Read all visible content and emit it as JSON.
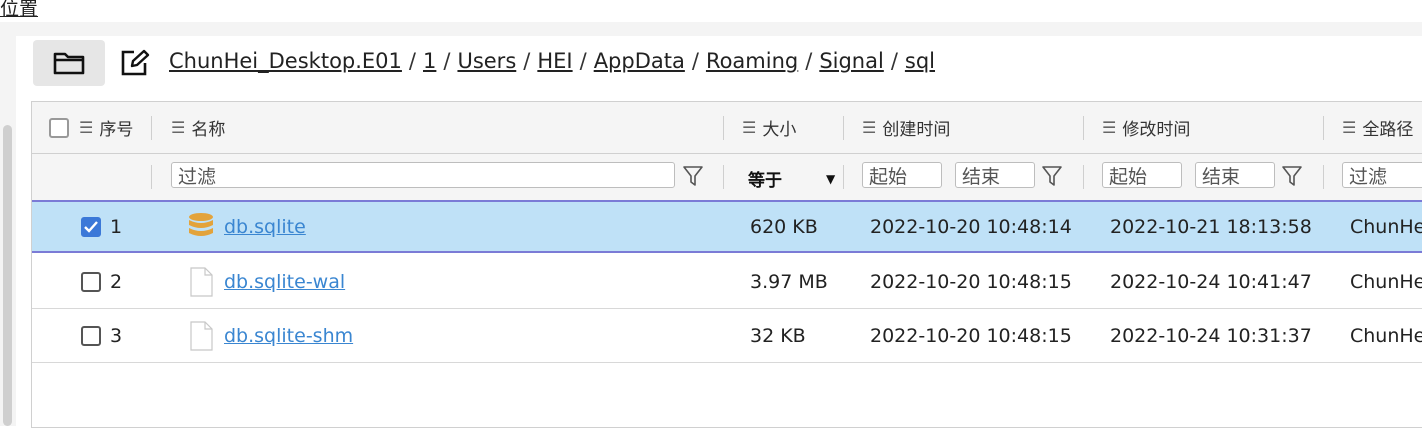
{
  "top_label": "位置",
  "breadcrumb": [
    {
      "label": "ChunHei_Desktop.E01"
    },
    {
      "label": "1"
    },
    {
      "label": "Users"
    },
    {
      "label": "HEI"
    },
    {
      "label": "AppData"
    },
    {
      "label": "Roaming"
    },
    {
      "label": "Signal"
    },
    {
      "label": "sql"
    }
  ],
  "breadcrumb_separator": "/",
  "columns": {
    "index": "序号",
    "name": "名称",
    "size": "大小",
    "created": "创建时间",
    "modified": "修改时间",
    "fullpath": "全路径"
  },
  "filters": {
    "name_placeholder": "过滤",
    "size_operator": "等于",
    "created_start": "起始",
    "created_end": "结束",
    "modified_start": "起始",
    "modified_end": "结束",
    "fullpath_placeholder": "过滤"
  },
  "rows": [
    {
      "index": "1",
      "checked": true,
      "icon": "database-icon",
      "name": "db.sqlite",
      "size": "620 KB",
      "created": "2022-10-20 10:48:14",
      "modified": "2022-10-21 18:13:58",
      "fullpath": "ChunHe"
    },
    {
      "index": "2",
      "checked": false,
      "icon": "file-icon",
      "name": "db.sqlite-wal",
      "size": "3.97 MB",
      "created": "2022-10-20 10:48:15",
      "modified": "2022-10-24 10:41:47",
      "fullpath": "ChunHe"
    },
    {
      "index": "3",
      "checked": false,
      "icon": "file-icon",
      "name": "db.sqlite-shm",
      "size": "32 KB",
      "created": "2022-10-20 10:48:15",
      "modified": "2022-10-24 10:31:37",
      "fullpath": "ChunHe"
    }
  ],
  "colors": {
    "selected_row": "#bfe1f7",
    "link": "#3a86d1",
    "checkbox_checked": "#3b78d8",
    "database_icon": "#e3a33b"
  }
}
